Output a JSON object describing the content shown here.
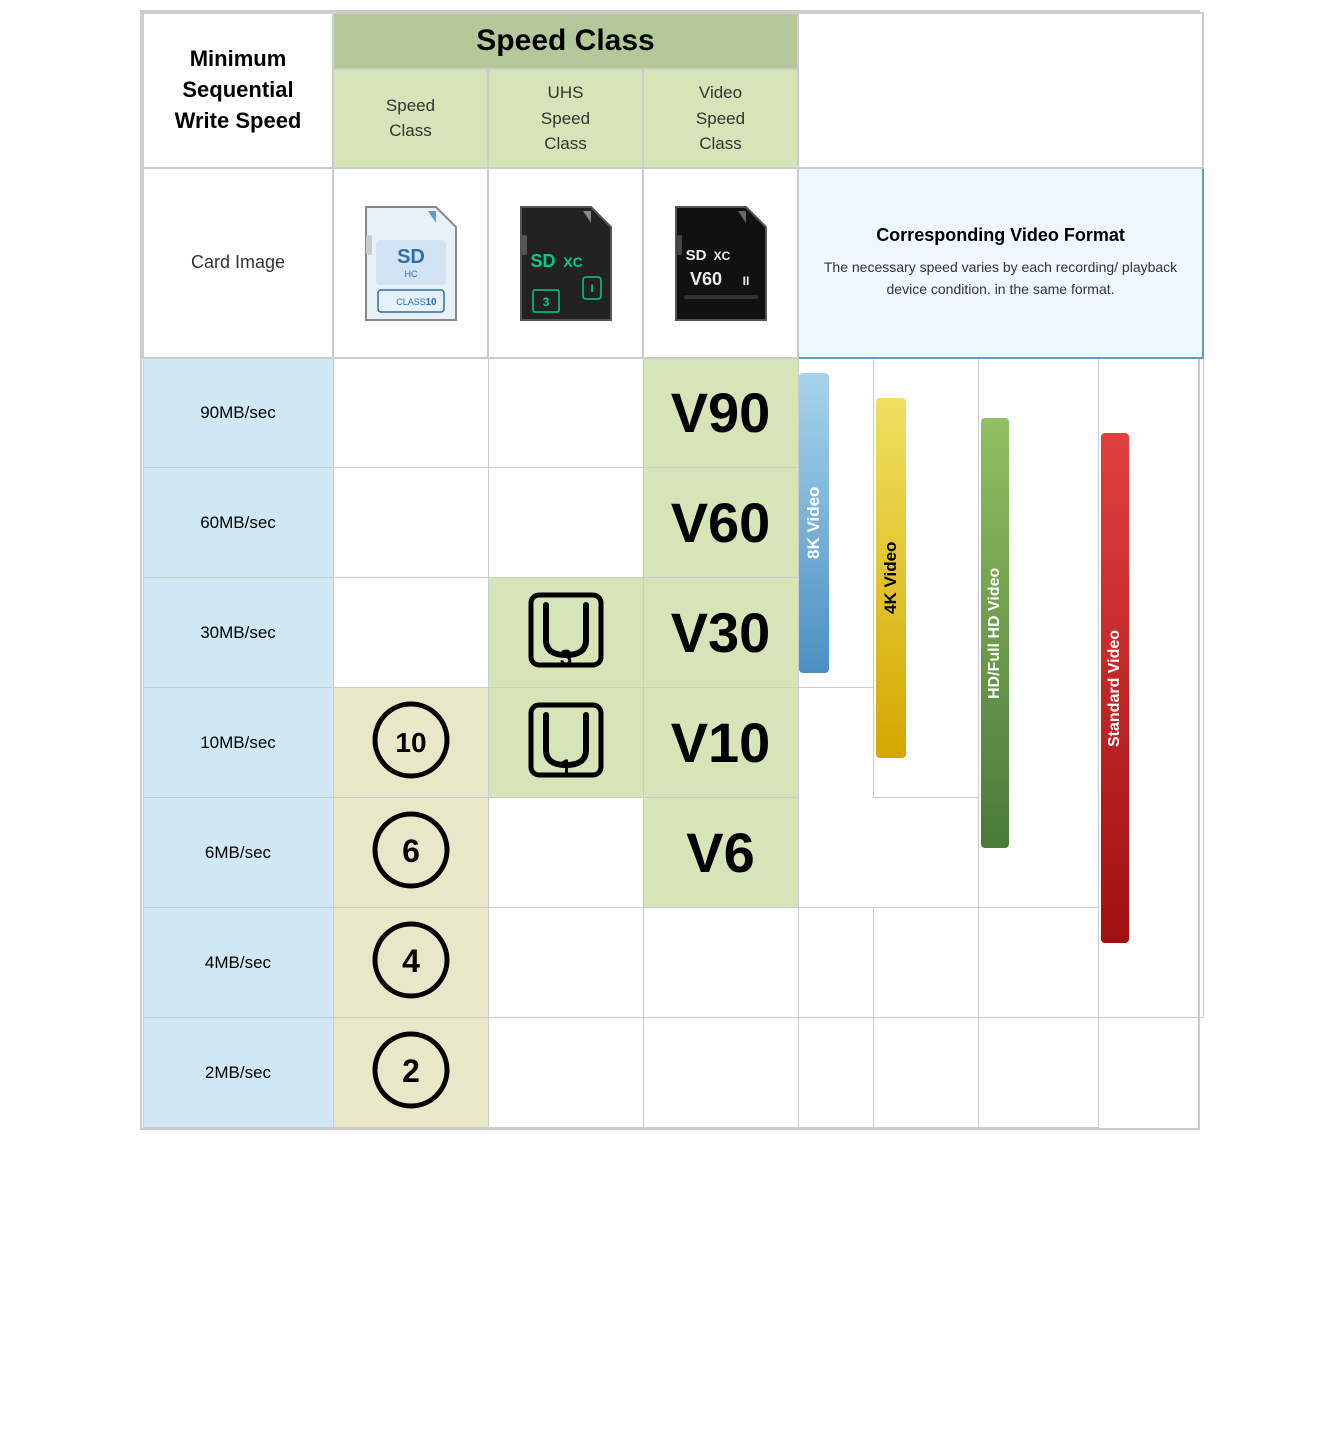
{
  "header": {
    "min_write_label": "Minimum\nSequential\nWrite Speed",
    "speed_class_title": "Speed Class",
    "sub_col1": "Speed\nClass",
    "sub_col2": "UHS\nSpeed\nClass",
    "sub_col3": "Video\nSpeed\nClass"
  },
  "card_row": {
    "label": "Card Image",
    "video_format_title": "Corresponding Video Format",
    "video_format_desc": "The necessary speed varies by each recording/ playback device condition. in the same format."
  },
  "rows": [
    {
      "speed": "90MB/sec",
      "sc": "",
      "uhs": "",
      "vsc": "V90"
    },
    {
      "speed": "60MB/sec",
      "sc": "",
      "uhs": "",
      "vsc": "V60"
    },
    {
      "speed": "30MB/sec",
      "sc": "",
      "uhs": "U3",
      "vsc": "V30"
    },
    {
      "speed": "10MB/sec",
      "sc": "C10",
      "uhs": "U1",
      "vsc": "V10"
    },
    {
      "speed": "6MB/sec",
      "sc": "C6",
      "uhs": "",
      "vsc": "V6"
    },
    {
      "speed": "4MB/sec",
      "sc": "C4",
      "uhs": "",
      "vsc": ""
    },
    {
      "speed": "2MB/sec",
      "sc": "C2",
      "uhs": "",
      "vsc": ""
    }
  ],
  "video_labels": {
    "v8k": "8K Video",
    "v4k": "4K Video",
    "vhd": "HD/Full HD Video",
    "vstd": "Standard Video"
  },
  "colors": {
    "green_header": "#b5c89a",
    "green_light": "#d6e4b8",
    "blue_header": "#5aa0c0",
    "blue_light": "#d0e8f4",
    "tan": "#e8e8c8",
    "white": "#ffffff"
  }
}
